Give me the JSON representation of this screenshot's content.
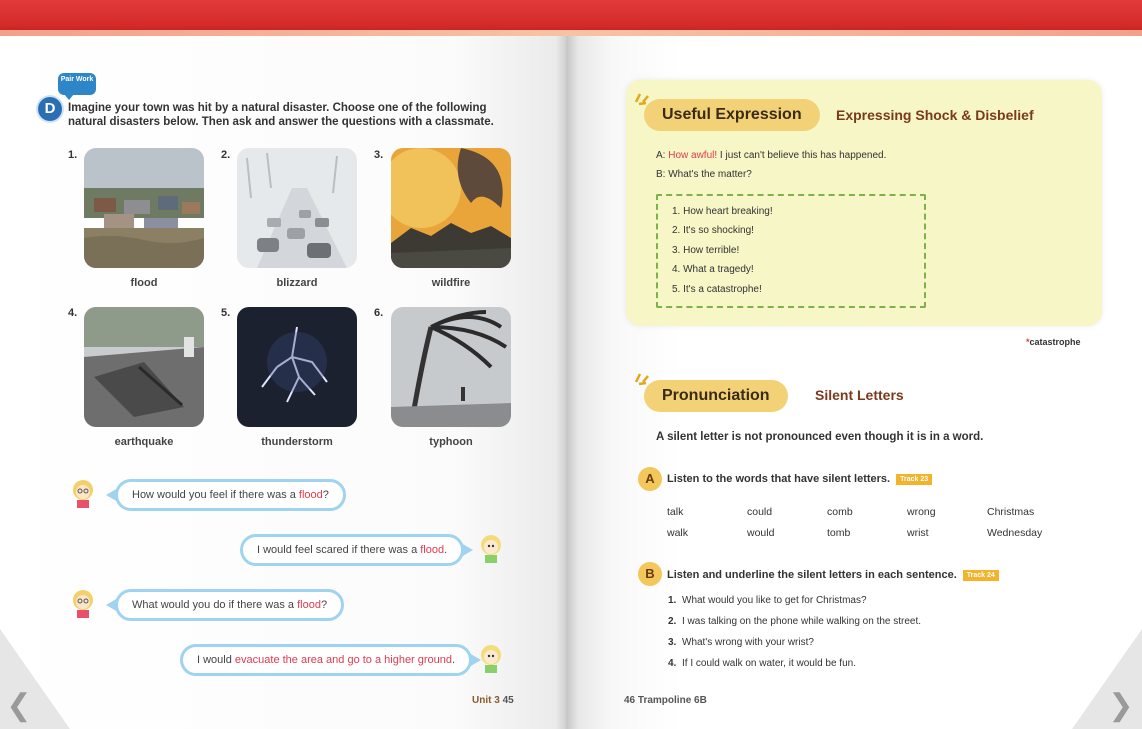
{
  "left_page": {
    "pair_work": "Pair Work",
    "activity_letter": "D",
    "instruction": "Imagine your town was hit by a natural disaster. Choose one of the following natural disasters below. Then ask and answer the questions with a classmate.",
    "disasters": [
      {
        "number": "1.",
        "label": "flood"
      },
      {
        "number": "2.",
        "label": "blizzard"
      },
      {
        "number": "3.",
        "label": "wildfire"
      },
      {
        "number": "4.",
        "label": "earthquake"
      },
      {
        "number": "5.",
        "label": "thunderstorm"
      },
      {
        "number": "6.",
        "label": "typhoon"
      }
    ],
    "dialog": [
      {
        "pre": "How would you feel if there was a ",
        "hl": "flood",
        "post": "?"
      },
      {
        "pre": "I would feel scared if there was a ",
        "hl": "flood",
        "post": "."
      },
      {
        "pre": "What would you do if there was a ",
        "hl": "flood",
        "post": "?"
      },
      {
        "pre": "I would ",
        "hl": "evacuate the area and go to a higher ground",
        "post": "."
      }
    ],
    "page_number": {
      "unit": "Unit 3",
      "num": "45"
    }
  },
  "right_page": {
    "useful_expression": {
      "title": "Useful Expression",
      "subtitle": "Expressing Shock & Disbelief",
      "line_a_prefix": "A: ",
      "line_a_hl": "How awful!",
      "line_a_rest": " I just can't believe this has happened.",
      "line_b": "B: What's the matter?",
      "items": [
        "1. How heart breaking!",
        "2. It's so shocking!",
        "3. How terrible!",
        "4. What a tragedy!",
        "5. It's a catastrophe!"
      ],
      "footnote_mark": "*",
      "footnote": "catastrophe"
    },
    "pronunciation": {
      "title": "Pronunciation",
      "subtitle": "Silent Letters",
      "lead": "A silent letter is not pronounced even though it is in a word.",
      "task_a": {
        "letter": "A",
        "text": "Listen to the words that have silent letters.",
        "track": "Track 23"
      },
      "words_row1": [
        "talk",
        "could",
        "comb",
        "wrong",
        "Christmas"
      ],
      "words_row2": [
        "walk",
        "would",
        "tomb",
        "wrist",
        "Wednesday"
      ],
      "task_b": {
        "letter": "B",
        "text": "Listen and underline the silent letters in each sentence.",
        "track": "Track 24"
      },
      "sentences": [
        {
          "n": "1.",
          "t": "What would you like to get for Christmas?"
        },
        {
          "n": "2.",
          "t": "I was talking on the phone while walking on the street."
        },
        {
          "n": "3.",
          "t": "What's wrong with your wrist?"
        },
        {
          "n": "4.",
          "t": "If I could walk on water, it would be fun."
        }
      ]
    },
    "page_number": {
      "num": "46",
      "book": "Trampoline 6B"
    }
  },
  "colors": {
    "accent_red": "#e23a4d",
    "pill_yellow": "#f3d277",
    "box_yellow": "#f6f6c6",
    "bubble_blue": "#9fd3ef"
  }
}
